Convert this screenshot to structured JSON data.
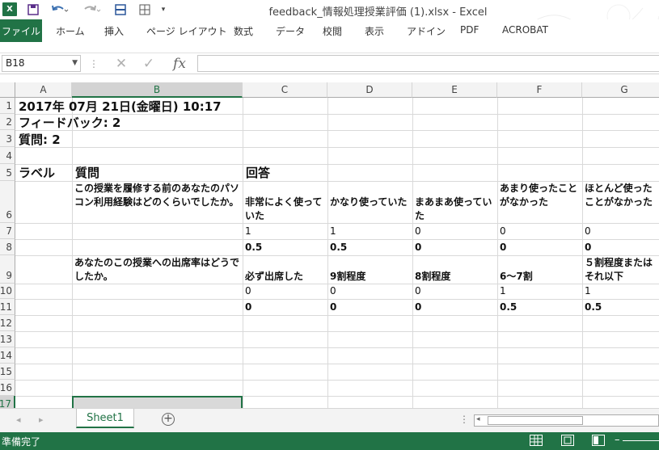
{
  "window": {
    "title": "feedback_情報処理授業評価 (1).xlsx - Excel",
    "logo_letter": "X",
    "accent": "#217346"
  },
  "quick_access": {
    "save_icon": "save-icon",
    "undo_icon": "undo-icon",
    "redo_icon": "redo-icon"
  },
  "ribbon": {
    "tabs": [
      "ファイル",
      "ホーム",
      "挿入",
      "ページ レイアウト",
      "数式",
      "データ",
      "校閲",
      "表示",
      "アドイン",
      "PDF",
      "ACROBAT"
    ]
  },
  "formula_bar": {
    "name_box": "B18",
    "fx_label": "fx",
    "value": ""
  },
  "columns": [
    "A",
    "B",
    "C",
    "D",
    "E",
    "F",
    "G"
  ],
  "rows": [
    "1",
    "2",
    "3",
    "4",
    "5",
    "6",
    "7",
    "8",
    "9",
    "10",
    "11",
    "12",
    "13",
    "14",
    "15",
    "16",
    "17"
  ],
  "cells": {
    "a1": "2017年 07月 21日(金曜日) 10:17",
    "a2": "フィードバック: 2",
    "a3": "質問: 2",
    "a5": "ラベル",
    "b5": "質問",
    "c5": "回答",
    "b6": "この授業を履修する前のあなたのパソコン利用経験はどのくらいでしたか。",
    "c6": "非常によく使っていた",
    "d6": "かなり使っていた",
    "e6": "まあまあ使っていた",
    "f6": "あまり使ったことがなかった",
    "g6": "ほとんど使ったことがなかった",
    "c7": "1",
    "d7": "1",
    "e7": "0",
    "f7": "0",
    "g7": "0",
    "c8": "0.5",
    "d8": "0.5",
    "e8": "0",
    "f8": "0",
    "g8": "0",
    "b9": "あなたのこの授業への出席率はどうでしたか。",
    "c9": "必ず出席した",
    "d9": "9割程度",
    "e9": "8割程度",
    "f9": "6〜7割",
    "g9": "５割程度またはそれ以下",
    "c10": "0",
    "d10": "0",
    "e10": "0",
    "f10": "1",
    "g10": "1",
    "c11": "0",
    "d11": "0",
    "e11": "0",
    "f11": "0.5",
    "g11": "0.5"
  },
  "sheet_tabs": {
    "active": "Sheet1",
    "add_label": "+"
  },
  "status": {
    "text": "準備完了"
  }
}
